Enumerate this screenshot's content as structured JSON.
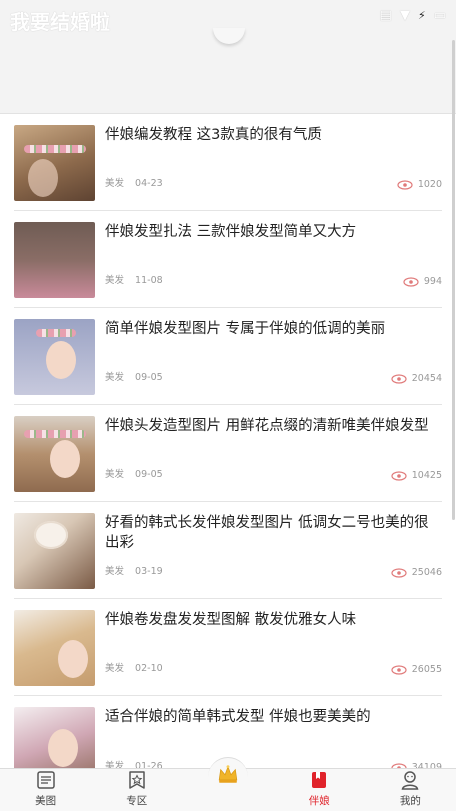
{
  "status_bar": {
    "app_title": "我要结婚啦",
    "time_text": "",
    "icons": [
      "signal-icon",
      "wifi-icon",
      "charging-icon",
      "battery-icon"
    ]
  },
  "articles": [
    {
      "title": "伴娘编发教程 这3款真的很有气质",
      "category": "美发",
      "date": "04-23",
      "views": "1020"
    },
    {
      "title": "伴娘发型扎法 三款伴娘发型简单又大方",
      "category": "美发",
      "date": "11-08",
      "views": "994"
    },
    {
      "title": "简单伴娘发型图片 专属于伴娘的低调的美丽",
      "category": "美发",
      "date": "09-05",
      "views": "20454"
    },
    {
      "title": "伴娘头发造型图片 用鲜花点缀的清新唯美伴娘发型",
      "category": "美发",
      "date": "09-05",
      "views": "10425"
    },
    {
      "title": "好看的韩式长发伴娘发型图片 低调女二号也美的很出彩",
      "category": "美发",
      "date": "03-19",
      "views": "25046"
    },
    {
      "title": "伴娘卷发盘发发型图解 散发优雅女人味",
      "category": "美发",
      "date": "02-10",
      "views": "26055"
    },
    {
      "title": "适合伴娘的简单韩式发型 伴娘也要美美的",
      "category": "美发",
      "date": "01-26",
      "views": "34109"
    }
  ],
  "tabbar": {
    "tabs": [
      {
        "label": "美图",
        "icon": "newspaper-icon"
      },
      {
        "label": "专区",
        "icon": "star-badge-icon"
      },
      {
        "label": "",
        "icon": "crown-icon"
      },
      {
        "label": "伴娘",
        "icon": "bookmark-icon",
        "active": true
      },
      {
        "label": "我的",
        "icon": "user-icon"
      }
    ]
  },
  "colors": {
    "accent": "#e0232b",
    "meta_text": "#999999",
    "eye_icon": "#e07a7a",
    "crown": "#f0b429"
  }
}
